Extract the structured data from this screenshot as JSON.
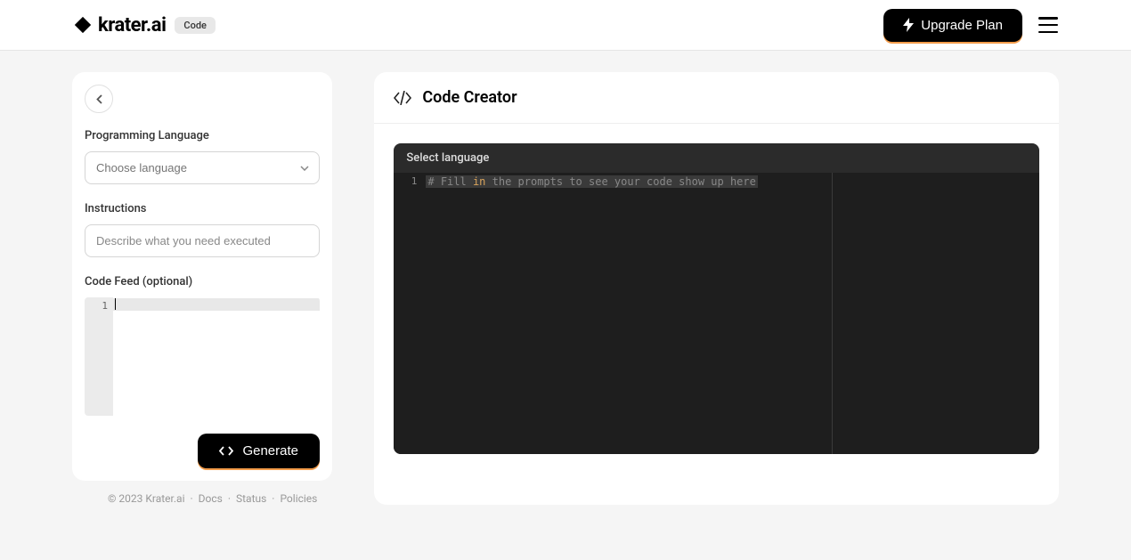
{
  "header": {
    "logo_text": "krater.ai",
    "badge": "Code",
    "upgrade_label": "Upgrade Plan"
  },
  "sidebar": {
    "language_label": "Programming Language",
    "language_placeholder": "Choose language",
    "instructions_label": "Instructions",
    "instructions_placeholder": "Describe what you need executed",
    "code_feed_label": "Code Feed (optional)",
    "feed_line_number": "1",
    "generate_label": "Generate"
  },
  "footer": {
    "copyright": "© 2023 Krater.ai",
    "sep": "·",
    "docs": "Docs",
    "status": "Status",
    "policies": "Policies"
  },
  "output": {
    "title": "Code Creator",
    "code_header": "Select language",
    "line_number": "1",
    "tokens": {
      "t1": "# Fill ",
      "t2": "in",
      "t3": " the prompts to see your code show up here"
    }
  }
}
